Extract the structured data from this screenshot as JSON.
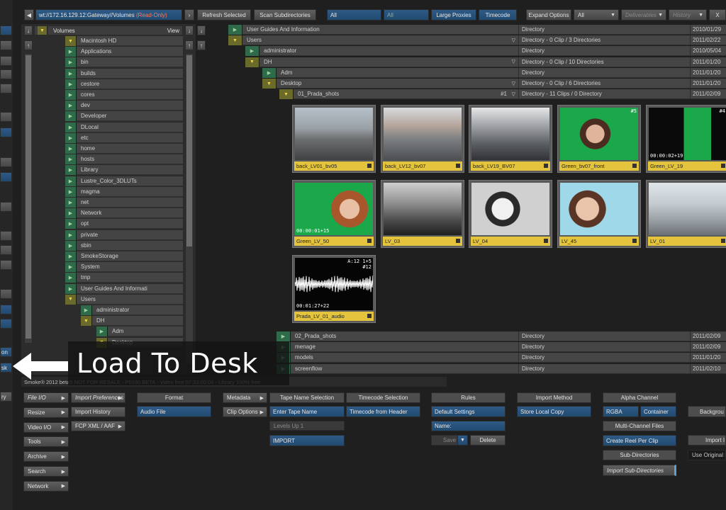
{
  "toolbar": {
    "path": "wt://172.16.129.12:Gateway//Volumes",
    "read_only": "(Read-Only)",
    "refresh": "Refresh Selected",
    "scan": "Scan Subdirectories",
    "filter_all": "All",
    "filter_all2": "All",
    "large_proxies": "Large Proxies",
    "timecode": "Timecode",
    "expand_options": "Expand Options",
    "expand_value": "All",
    "deliverables": "Deliverables",
    "history": "History",
    "close": "X"
  },
  "tree": {
    "header": "Volumes",
    "view": "View",
    "items": [
      {
        "label": "Macintosh HD",
        "open": true
      },
      {
        "label": "Applications",
        "open": false
      },
      {
        "label": "bin",
        "open": false
      },
      {
        "label": "builds",
        "open": false
      },
      {
        "label": "cestore",
        "open": false
      },
      {
        "label": "cores",
        "open": false
      },
      {
        "label": "dev",
        "open": false
      },
      {
        "label": "Developer",
        "open": false
      },
      {
        "label": "DLocal",
        "open": false
      },
      {
        "label": "etc",
        "open": false
      },
      {
        "label": "home",
        "open": false
      },
      {
        "label": "hosts",
        "open": false
      },
      {
        "label": "Library",
        "open": false
      },
      {
        "label": "Lustre_Color_3DLUTs",
        "open": false
      },
      {
        "label": "magma",
        "open": false
      },
      {
        "label": "net",
        "open": false
      },
      {
        "label": "Network",
        "open": false
      },
      {
        "label": "opt",
        "open": false
      },
      {
        "label": "private",
        "open": false
      },
      {
        "label": "sbin",
        "open": false
      },
      {
        "label": "SmokeStorage",
        "open": false
      },
      {
        "label": "System",
        "open": false
      },
      {
        "label": "tmp",
        "open": false
      },
      {
        "label": "User Guides And Informati",
        "open": false
      },
      {
        "label": "Users",
        "open": true
      },
      {
        "label": "administrator",
        "open": false
      },
      {
        "label": "DH",
        "open": true
      },
      {
        "label": "Adm",
        "open": false
      },
      {
        "label": "Desktop",
        "open": true
      }
    ]
  },
  "dirs": [
    {
      "name": "User Guides And Information",
      "type": "Directory",
      "date": "2010/01/29",
      "indent": 0,
      "open": false,
      "tag": ""
    },
    {
      "name": "Users",
      "type": "Directory - 0 Clip / 3 Directories",
      "date": "2011/02/22",
      "indent": 0,
      "open": true,
      "tag": ""
    },
    {
      "name": "administrator",
      "type": "Directory",
      "date": "2010/05/04",
      "indent": 1,
      "open": false,
      "tag": ""
    },
    {
      "name": "DH",
      "type": "Directory - 0 Clip / 10 Directories",
      "date": "2011/01/20",
      "indent": 1,
      "open": true,
      "tag": ""
    },
    {
      "name": "Adm",
      "type": "Directory",
      "date": "2011/01/20",
      "indent": 2,
      "open": false,
      "tag": ""
    },
    {
      "name": "Desktop",
      "type": "Directory - 0 Clip / 6 Directories",
      "date": "2011/01/20",
      "indent": 2,
      "open": true,
      "tag": ""
    },
    {
      "name": "01_Prada_shots",
      "type": "Directory - 11 Clips / 0 Directory",
      "date": "2011/02/09",
      "indent": 3,
      "open": true,
      "tag": "#1"
    }
  ],
  "clips": [
    {
      "name": "back_LV01_bv05",
      "tc": "",
      "frames": "",
      "kind": "street"
    },
    {
      "name": "back_LV12_bv07",
      "tc": "",
      "frames": "",
      "kind": "street2"
    },
    {
      "name": "back_LV19_BV07",
      "tc": "",
      "frames": "",
      "kind": "street3"
    },
    {
      "name": "Green_bv07_front",
      "tc": "",
      "frames": "#5",
      "kind": "green"
    },
    {
      "name": "Green_LV_19",
      "tc": "00:00:02+19",
      "frames": "#4",
      "kind": "greendark"
    },
    {
      "name": "Green_LV_50",
      "tc": "00:00:01+15",
      "frames": "",
      "kind": "green2"
    },
    {
      "name": "LV_03",
      "tc": "",
      "frames": "",
      "kind": "bw"
    },
    {
      "name": "LV_04",
      "tc": "",
      "frames": "",
      "kind": "bwface"
    },
    {
      "name": "LV_45",
      "tc": "",
      "frames": "",
      "kind": "face"
    },
    {
      "name": "LV_01",
      "tc": "",
      "frames": "",
      "kind": "street4"
    },
    {
      "name": "Prada_LV_01_audio",
      "tc": "00:01:27+22",
      "frames": "A:12 1+5 #12",
      "kind": "audio"
    }
  ],
  "lower_dirs": [
    {
      "name": "02_Prada_shots",
      "type": "Directory",
      "date": "2011/02/09"
    },
    {
      "name": "menage",
      "type": "Directory",
      "date": "2011/02/09"
    },
    {
      "name": "models",
      "type": "Directory",
      "date": "2011/01/20"
    },
    {
      "name": "screenflow",
      "type": "Directory",
      "date": "2011/02/10"
    }
  ],
  "status": "Smoke® 2012 beta5 NOT FOR RESALE - P5190 BETA - Video free 07:33:00:04 - Library 100% free",
  "callout": "Load To Desk",
  "side_buttons": [
    {
      "label": "File I/O"
    },
    {
      "label": "Resize"
    },
    {
      "label": "Video I/O"
    },
    {
      "label": "Tools"
    },
    {
      "label": "Archive"
    },
    {
      "label": "Search"
    },
    {
      "label": "Network"
    }
  ],
  "import": {
    "import_prefs": "Import Preferences",
    "import_history": "Import History",
    "fcp": "FCP XML / AAF",
    "format_hdr": "Format",
    "audio_file": "Audio File",
    "metadata": "Metadata",
    "clip_options": "Clip Options",
    "tape_hdr": "Tape Name Selection",
    "enter_tape": "Enter Tape Name",
    "levels": "Levels Up 1",
    "import_btn": "IMPORT",
    "timecode_hdr": "Timecode Selection",
    "tc_from_header": "Timecode from Header",
    "rules_hdr": "Rules",
    "default_settings": "Default Settings",
    "name_label": "Name:",
    "save": "Save",
    "delete": "Delete",
    "method_hdr": "Import Method",
    "store_local": "Store Local Copy",
    "alpha_hdr": "Alpha Channel",
    "rgba": "RGBA",
    "container": "Container",
    "multi_channel": "Multi-Channel Files",
    "create_reel": "Create Reel Per Clip",
    "sub_dirs": "Sub-Directories",
    "import_sub": "Import Sub-Directories",
    "background": "Backgrou",
    "import_right": "Import I",
    "use_original": "Use Original M"
  },
  "left_edge": {
    "ry": "ry",
    "on": "on",
    "sk": "sk"
  }
}
